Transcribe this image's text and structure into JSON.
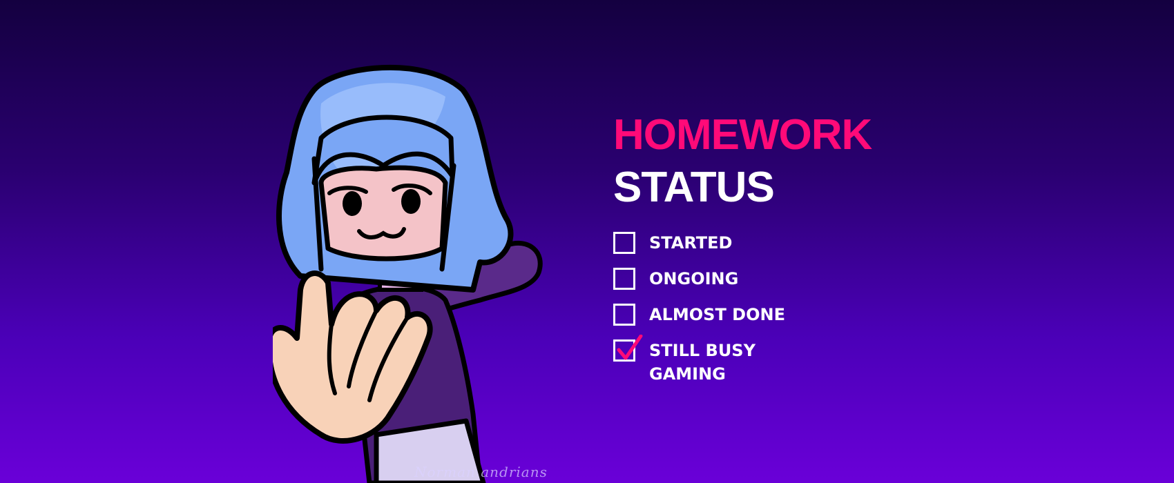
{
  "header": {
    "title_line1": "HOMEWORK",
    "title_line2": "STATUS"
  },
  "checklist": [
    {
      "label": "STARTED",
      "checked": false
    },
    {
      "label": "ONGOING",
      "checked": false
    },
    {
      "label": "ALMOST DONE",
      "checked": false
    },
    {
      "label": "STILL BUSY GAMING",
      "checked": true
    }
  ],
  "signature": "Norman andrians",
  "colors": {
    "accent": "#ff0a78",
    "background_top": "#140040",
    "background_bottom": "#6a00d8",
    "text": "#ffffff"
  },
  "icons": {
    "checkmark": "checkmark-icon"
  }
}
